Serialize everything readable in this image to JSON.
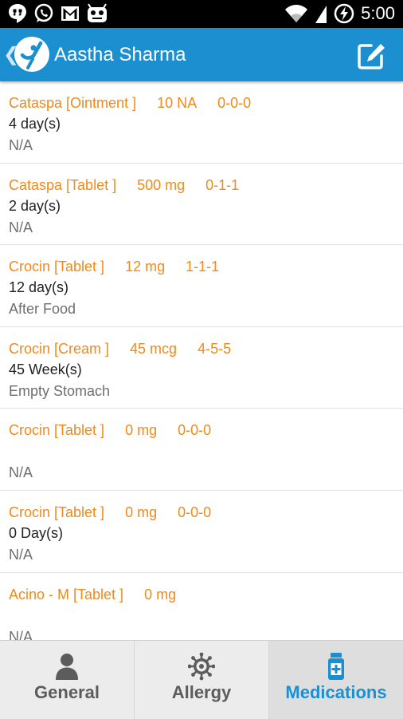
{
  "status_bar": {
    "time": "5:00",
    "icons": [
      "hangouts-icon",
      "whatsapp-icon",
      "gmail-icon",
      "android-debug-icon",
      "wifi-icon",
      "signal-icon",
      "battery-charging-icon"
    ]
  },
  "app_bar": {
    "title": "Aastha Sharma",
    "icons": [
      "back-chevron-icon",
      "app-logo-icon",
      "edit-icon"
    ]
  },
  "medications": [
    {
      "name": "Cataspa [Ointment ]",
      "dose": "10 NA",
      "schedule": "0-0-0",
      "duration": "4 day(s)",
      "instruction": "N/A"
    },
    {
      "name": "Cataspa [Tablet ]",
      "dose": "500 mg",
      "schedule": "0-1-1",
      "duration": "2 day(s)",
      "instruction": "N/A"
    },
    {
      "name": "Crocin [Tablet ]",
      "dose": "12 mg",
      "schedule": "1-1-1",
      "duration": "12 day(s)",
      "instruction": "After Food"
    },
    {
      "name": "Crocin [Cream ]",
      "dose": "45 mcg",
      "schedule": "4-5-5",
      "duration": "45 Week(s)",
      "instruction": "Empty Stomach"
    },
    {
      "name": "Crocin [Tablet ]",
      "dose": "0 mg",
      "schedule": "0-0-0",
      "duration": "",
      "instruction": "N/A"
    },
    {
      "name": "Crocin [Tablet ]",
      "dose": "0 mg",
      "schedule": "0-0-0",
      "duration": "0 Day(s)",
      "instruction": "N/A"
    },
    {
      "name": "Acino - M [Tablet ]",
      "dose": "0 mg",
      "schedule": "",
      "duration": "",
      "instruction": "N/A"
    }
  ],
  "tabs": [
    {
      "label": "General",
      "icon": "person-icon",
      "active": false
    },
    {
      "label": "Allergy",
      "icon": "virus-icon",
      "active": false
    },
    {
      "label": "Medications",
      "icon": "medicine-bottle-icon",
      "active": true
    }
  ],
  "colors": {
    "app_bar": "#1c8fd1",
    "medication_title": "#f08a1c",
    "active_tab_label": "#1c8fd1",
    "inactive_tab_label": "#5c5c5c"
  }
}
